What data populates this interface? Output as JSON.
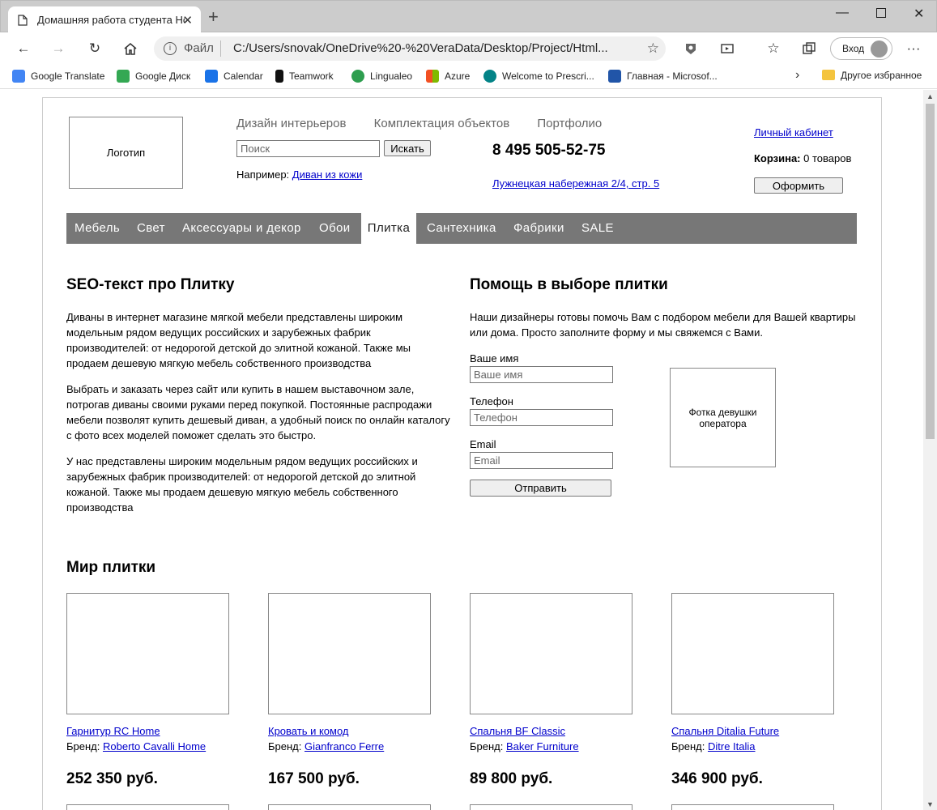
{
  "browser": {
    "tab_title": "Домашняя работа студента Hom",
    "address_scheme": "Файл",
    "address_url": "C:/Users/snovak/OneDrive%20-%20VeraData/Desktop/Project/Html...",
    "signin_label": "Вход",
    "bookmarks": [
      {
        "label": "Google Translate",
        "icon": "google-translate-icon",
        "color": "#4285f4"
      },
      {
        "label": "Google Диск",
        "icon": "google-drive-icon",
        "color": "#34a853"
      },
      {
        "label": "Calendar",
        "icon": "calendar-icon",
        "color": "#1a73e8"
      },
      {
        "label": "Teamwork",
        "icon": "teamwork-icon",
        "color": "#111111"
      },
      {
        "label": "Lingualeo",
        "icon": "lingualeo-icon",
        "color": "#2e9e4f"
      },
      {
        "label": "Azure",
        "icon": "azure-icon",
        "color": "#f25022"
      },
      {
        "label": "Welcome to Prescri...",
        "icon": "sharepoint-icon",
        "color": "#038387"
      },
      {
        "label": "Главная - Microsof...",
        "icon": "microsoft-icon",
        "color": "#2155a8"
      }
    ],
    "other_bookmarks": "Другое избранное"
  },
  "header": {
    "logo_label": "Логотип",
    "top_nav": [
      "Дизайн интерьеров",
      "Комплектация объектов",
      "Портфолио"
    ],
    "search_placeholder": "Поиск",
    "search_button": "Искать",
    "example_prefix": "Например: ",
    "example_link": "Диван из кожи",
    "phone": "8 495 505-52-75",
    "address": "Лужнецкая набережная 2/4, стр. 5",
    "account_link": "Личный кабинет",
    "cart_label": "Корзина:",
    "cart_value": " 0 товаров",
    "checkout_button": "Оформить"
  },
  "menu": {
    "items": [
      "Мебель",
      "Свет",
      "Аксессуары и декор",
      "Обои",
      "Плитка",
      "Сантехника",
      "Фабрики",
      "SALE"
    ],
    "active": "Плитка"
  },
  "seo": {
    "title": "SEO-текст про Плитку",
    "paragraphs": [
      "Диваны в интернет магазине мягкой мебели представлены широким модельным рядом ведущих российских и зарубежных фабрик производителей: от недорогой детской до элитной кожаной. Также мы продаем дешевую мягкую мебель собственного производства",
      "Выбрать и заказать через сайт или купить в нашем выставочном зале, потрогав диваны своими руками перед покупкой. Постоянные распродажи мебели позволят купить дешевый диван, а удобный поиск по онлайн каталогу с фото всех моделей поможет сделать это быстро.",
      "У нас представлены широким модельным рядом ведущих российских и зарубежных фабрик производителей: от недорогой детской до элитной кожаной. Также мы продаем дешевую мягкую мебель собственного производства"
    ]
  },
  "help_form": {
    "title": "Помощь в выборе плитки",
    "intro": "Наши дизайнеры готовы помочь Вам с подбором мебели для Вашей квартиры или дома. Просто заполните форму и мы свяжемся с Вами.",
    "name_label": "Ваше имя",
    "name_placeholder": "Ваше имя",
    "phone_label": "Телефон",
    "phone_placeholder": "Телефон",
    "email_label": "Email",
    "email_placeholder": "Email",
    "submit": "Отправить",
    "operator_photo": "Фотка девушки оператора"
  },
  "catalog": {
    "title": "Мир плитки",
    "brand_prefix": "Бренд: ",
    "products": [
      {
        "name": "Гарнитур RC Home",
        "brand": "Roberto Cavalli Home",
        "price": "252 350 руб."
      },
      {
        "name": "Кровать и комод",
        "brand": "Gianfranco Ferre",
        "price": "167 500 руб."
      },
      {
        "name": "Спальня BF Classic",
        "brand": "Baker Furniture",
        "price": "89 800 руб."
      },
      {
        "name": "Спальня Ditalia Future",
        "brand": "Ditre Italia",
        "price": "346 900 руб."
      }
    ]
  }
}
